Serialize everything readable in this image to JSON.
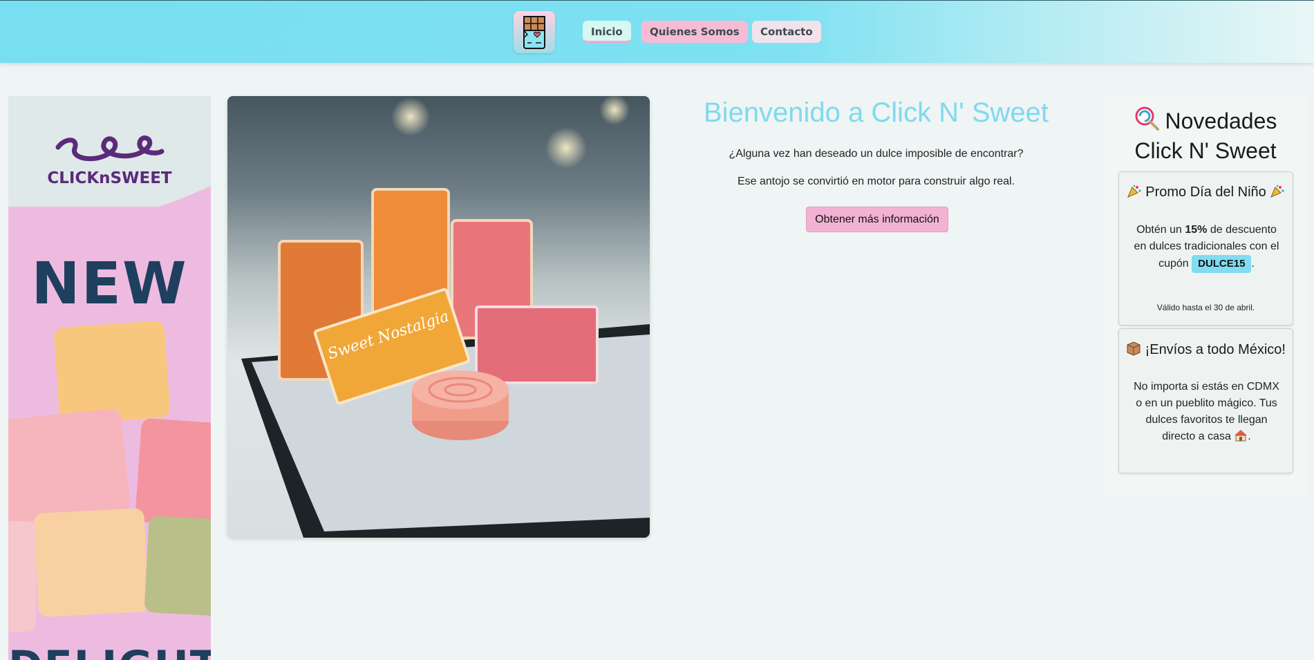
{
  "header": {
    "logo_icon": "chocolate-bar-heart-icon",
    "nav": [
      {
        "label": "Inicio"
      },
      {
        "label": "Quienes Somos"
      },
      {
        "label": "Contacto"
      }
    ]
  },
  "banner": {
    "brand": "CLICKnSWEET",
    "headline": "NEW",
    "footer_word": "DELIGHT"
  },
  "hero": {
    "product_text": "Sweet Nostalgia"
  },
  "welcome": {
    "title": "Bienvenido a Click N' Sweet",
    "line1": "¿Alguna vez han deseado un dulce imposible de encontrar?",
    "line2": "Ese antojo se convirtió en motor para construir algo real.",
    "cta_label": "Obtener más información"
  },
  "news": {
    "title_line1": "Novedades",
    "title_line2": "Click N' Sweet",
    "promo": {
      "title": "Promo Día del Niño",
      "text_before": "Obtén un ",
      "discount": "15%",
      "text_after": " de descuento en dulces tradicionales con el cupón ",
      "coupon": "DULCE15",
      "period": ".",
      "validity": "Válido hasta el 30 de abril."
    },
    "shipping": {
      "title": "¡Envíos a todo México!",
      "text": "No importa si estás en CDMX o en un pueblito mágico. Tus dulces favoritos te llegan directo a casa",
      "period": "."
    }
  },
  "colors": {
    "header": "#77dff1",
    "title": "#7fd9ef",
    "cta": "#f3b2d4",
    "coupon": "#7fdcf1",
    "page_bg": "#eef5f4"
  }
}
